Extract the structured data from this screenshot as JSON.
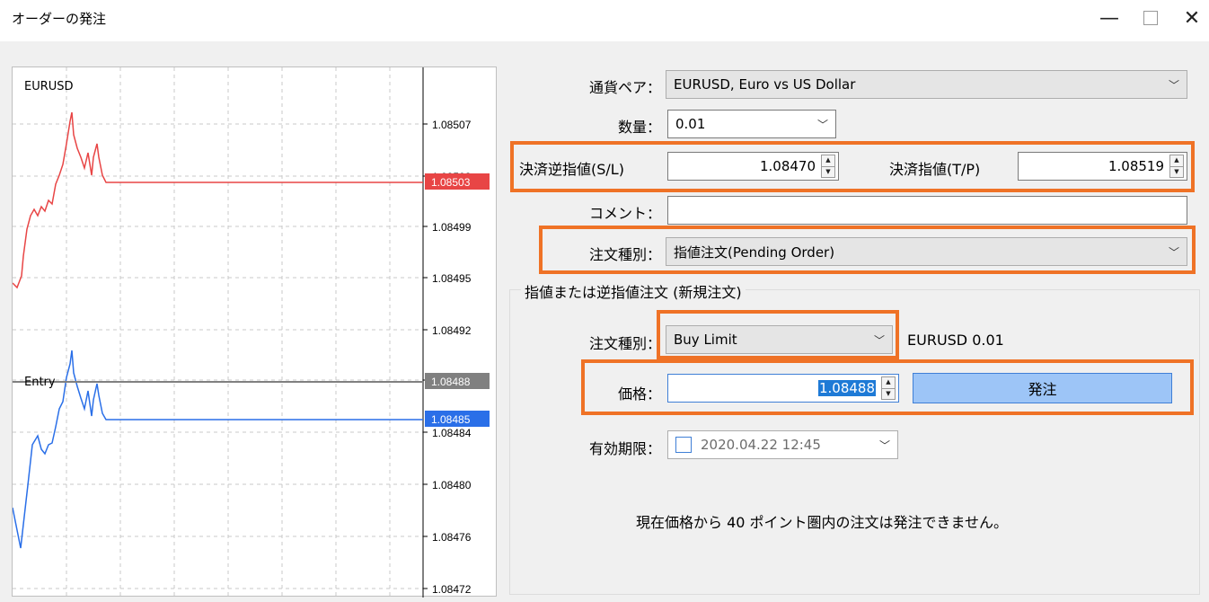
{
  "window": {
    "title": "オーダーの発注"
  },
  "chart": {
    "symbol": "EURUSD",
    "entry_label": "Entry",
    "price_labels": [
      "1.08507",
      "1.08503",
      "1.08499",
      "1.08495",
      "1.08492",
      "1.08488",
      "1.08484",
      "1.08480",
      "1.08476",
      "1.08472"
    ],
    "bid_tag": "1.08503",
    "entry_tag": "1.08488",
    "ask_tag": "1.08485",
    "bid_color": "#e84545",
    "ask_color": "#2a6fe8",
    "entry_color": "#808080"
  },
  "form": {
    "symbol_label": "通貨ペア：",
    "symbol_value": "EURUSD, Euro vs US Dollar",
    "volume_label": "数量：",
    "volume_value": "0.01",
    "sl_label": "決済逆指値(S/L)",
    "sl_value": "1.08470",
    "tp_label": "決済指値(T/P)",
    "tp_value": "1.08519",
    "comment_label": "コメント：",
    "comment_value": "",
    "type_label": "注文種別：",
    "type_value": "指値注文(Pending Order)"
  },
  "pending": {
    "group_title": "指値または逆指値注文 (新規注文)",
    "type_label": "注文種別：",
    "type_value": "Buy Limit",
    "type_info": "EURUSD 0.01",
    "price_label": "価格：",
    "price_value": "1.08488",
    "order_button": "発注",
    "expiry_label": "有効期限：",
    "expiry_value": "2020.04.22 12:45",
    "notice": "現在価格から 40 ポイント圏内の注文は発注できません。"
  },
  "highlight_color": "#ef7226"
}
